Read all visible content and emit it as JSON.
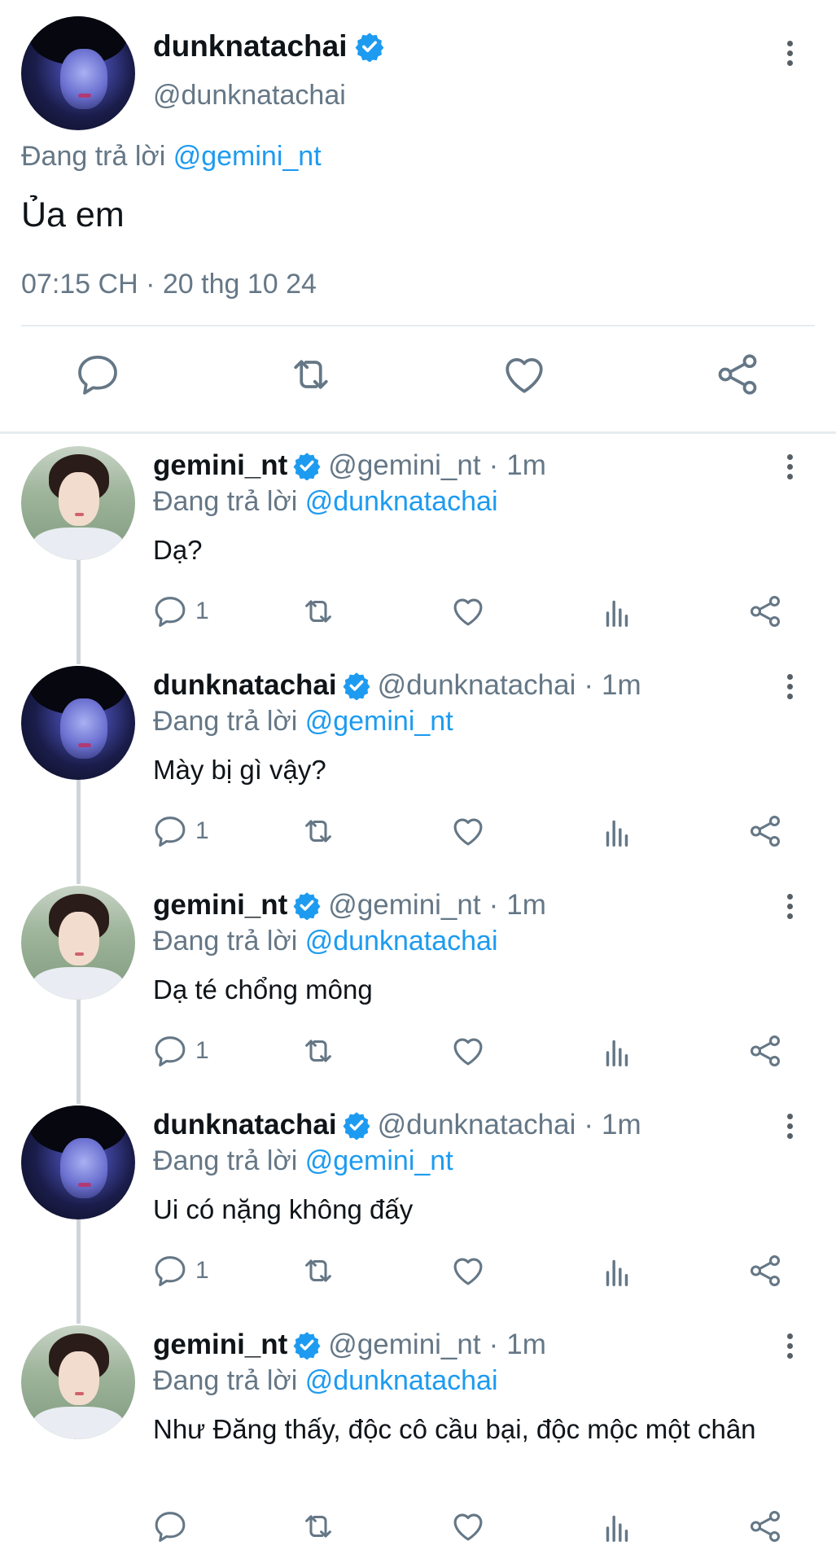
{
  "main_tweet": {
    "author_name": "dunknatachai",
    "author_handle": "@dunknatachai",
    "reply_prefix": "Đang trả lời",
    "reply_to": "@gemini_nt",
    "text": "Ủa em",
    "timestamp": "07:15 CH · 20 thg 10 24",
    "actions": [
      "reply-icon",
      "retweet-icon",
      "like-icon",
      "share-icon"
    ]
  },
  "replies": [
    {
      "author_name": "gemini_nt",
      "author_handle": "@gemini_nt",
      "age": "1m",
      "reply_prefix": "Đang trả lời",
      "reply_to": "@dunknatachai",
      "text": "Dạ?",
      "reply_count": "1"
    },
    {
      "author_name": "dunknatachai",
      "author_handle": "@dunknatachai",
      "age": "1m",
      "reply_prefix": "Đang trả lời",
      "reply_to": "@gemini_nt",
      "text": "Mày bị gì vậy?",
      "reply_count": "1"
    },
    {
      "author_name": "gemini_nt",
      "author_handle": "@gemini_nt",
      "age": "1m",
      "reply_prefix": "Đang trả lời",
      "reply_to": "@dunknatachai",
      "text": "Dạ té chổng mông",
      "reply_count": "1"
    },
    {
      "author_name": "dunknatachai",
      "author_handle": "@dunknatachai",
      "age": "1m",
      "reply_prefix": "Đang trả lời",
      "reply_to": "@gemini_nt",
      "text": "Ui có nặng không đấy",
      "reply_count": "1"
    },
    {
      "author_name": "gemini_nt",
      "author_handle": "@gemini_nt",
      "age": "1m",
      "reply_prefix": "Đang trả lời",
      "reply_to": "@dunknatachai",
      "text": "Như Đăng thấy, độc cô cầu bại, độc mộc một chân",
      "reply_count": ""
    }
  ],
  "meta_separator": "·",
  "colors": {
    "accent": "#1d9bf0",
    "secondary_text": "#657786",
    "icon": "#657786",
    "thread_line": "#ced5da"
  }
}
